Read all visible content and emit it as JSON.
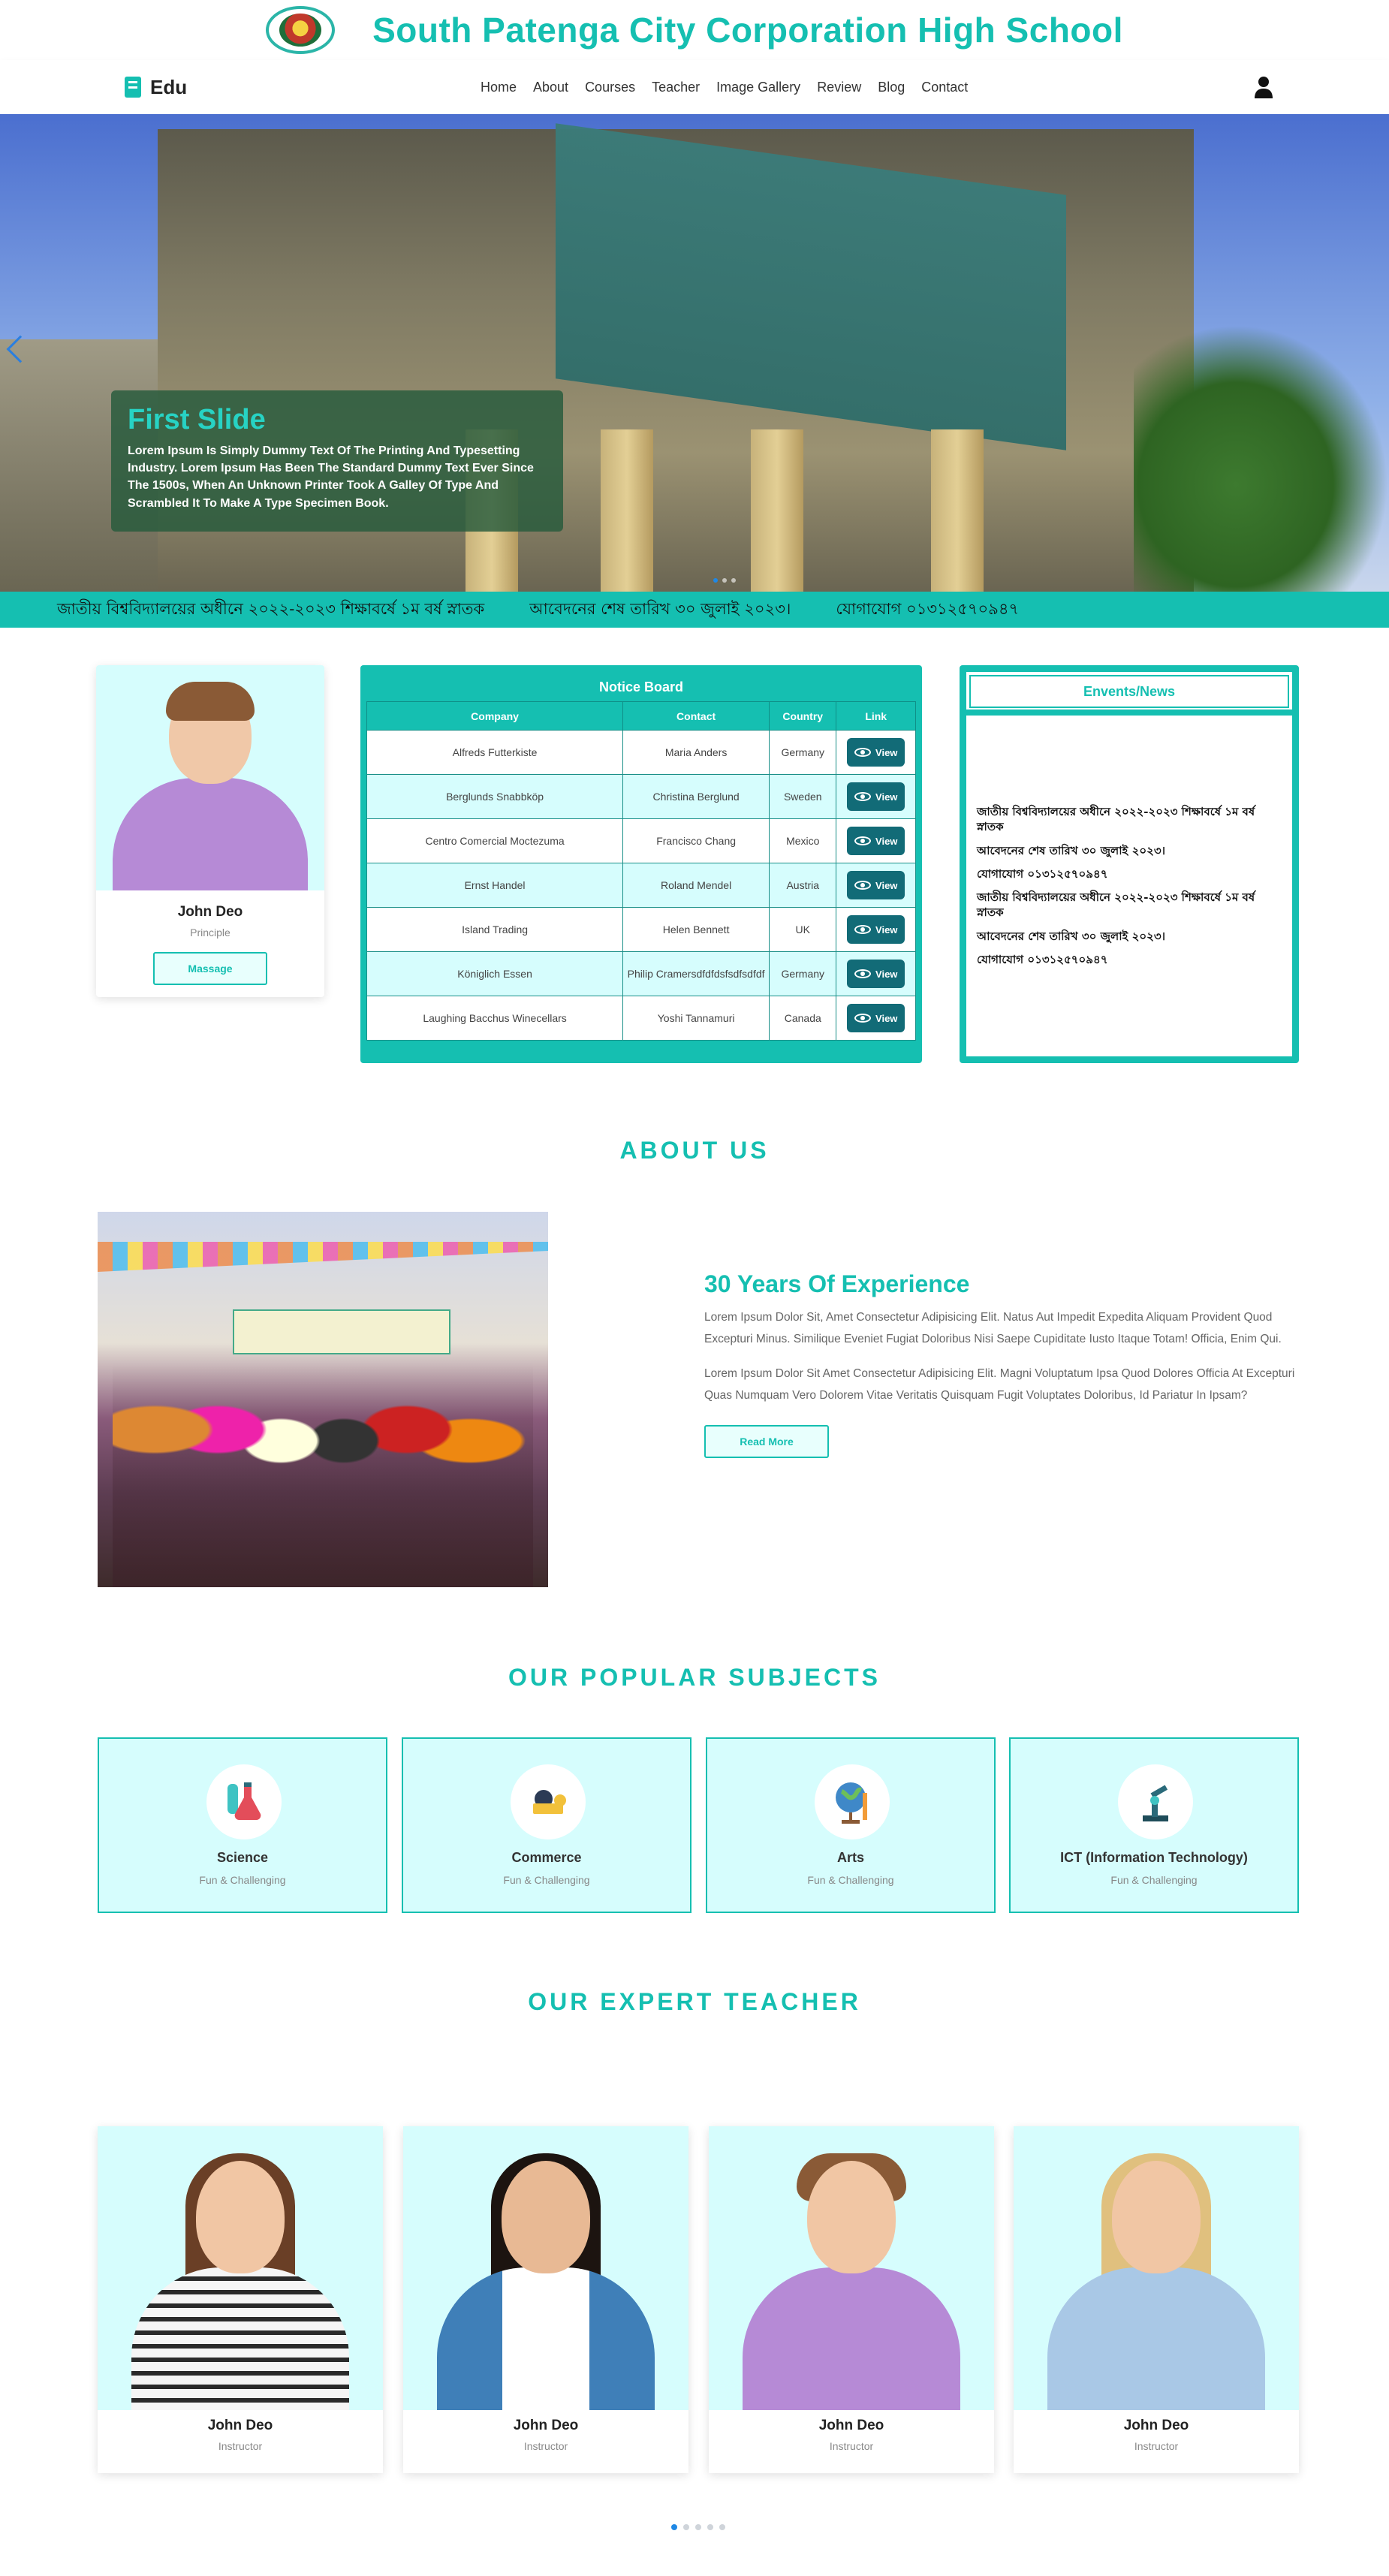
{
  "header": {
    "school_name": "South Patenga City Corporation High School"
  },
  "nav": {
    "brand": "Edu",
    "items": [
      "Home",
      "About",
      "Courses",
      "Teacher",
      "Image Gallery",
      "Review",
      "Blog",
      "Contact"
    ]
  },
  "hero": {
    "title": "First Slide",
    "text": "Lorem Ipsum Is Simply Dummy Text Of The Printing And Typesetting Industry. Lorem Ipsum Has Been The Standard Dummy Text Ever Since The 1500s, When An Unknown Printer Took A Galley Of Type And Scrambled It To Make A Type Specimen Book."
  },
  "marquee": {
    "items": [
      "জাতীয় বিশ্ববিদ্যালয়ের অধীনে ২০২২-২০২৩ শিক্ষাবর্ষে ১ম বর্ষ স্নাতক",
      "আবেদনের শেষ তারিখ ৩০ জুলাই ২০২৩।",
      "যোগাযোগ ০১৩১২৫৭০৯৪৭"
    ]
  },
  "principal": {
    "name": "John Deo",
    "role": "Principle",
    "button": "Massage"
  },
  "notice_board": {
    "title": "Notice Board",
    "columns": [
      "Company",
      "Contact",
      "Country",
      "Link"
    ],
    "view_label": "View",
    "rows": [
      [
        "Alfreds Futterkiste",
        "Maria Anders",
        "Germany"
      ],
      [
        "Berglunds Snabbköp",
        "Christina Berglund",
        "Sweden"
      ],
      [
        "Centro Comercial Moctezuma",
        "Francisco Chang",
        "Mexico"
      ],
      [
        "Ernst Handel",
        "Roland Mendel",
        "Austria"
      ],
      [
        "Island Trading",
        "Helen Bennett",
        "UK"
      ],
      [
        "Königlich Essen",
        "Philip Cramersdfdfdsfsdfsdfdf",
        "Germany"
      ],
      [
        "Laughing Bacchus Winecellars",
        "Yoshi Tannamuri",
        "Canada"
      ]
    ]
  },
  "events": {
    "title": "Envents/News",
    "items": [
      "জাতীয় বিশ্ববিদ্যালয়ের অধীনে ২০২২-২০২৩ শিক্ষাবর্ষে ১ম বর্ষ স্নাতক",
      "আবেদনের শেষ তারিখ ৩০ জুলাই ২০২৩।",
      "যোগাযোগ ০১৩১২৫৭০৯৪৭",
      "জাতীয় বিশ্ববিদ্যালয়ের অধীনে ২০২২-২০২৩ শিক্ষাবর্ষে ১ম বর্ষ স্নাতক",
      "আবেদনের শেষ তারিখ ৩০ জুলাই ২০২৩।",
      "যোগাযোগ ০১৩১২৫৭০৯৪৭"
    ]
  },
  "about": {
    "heading": "ABOUT US",
    "title": "30 Years Of Experience",
    "para1": "Lorem Ipsum Dolor Sit, Amet Consectetur Adipisicing Elit. Natus Aut Impedit Expedita Aliquam Provident Quod Excepturi Minus. Similique Eveniet Fugiat Doloribus Nisi Saepe Cupiditate Iusto Itaque Totam! Officia, Enim Qui.",
    "para2": "Lorem Ipsum Dolor Sit Amet Consectetur Adipisicing Elit. Magni Voluptatum Ipsa Quod Dolores Officia At Excepturi Quas Numquam Vero Dolorem Vitae Veritatis Quisquam Fugit Voluptates Doloribus, Id Pariatur In Ipsam?",
    "button": "Read More"
  },
  "subjects": {
    "heading": "OUR POPULAR SUBJECTS",
    "items": [
      {
        "name": "Science",
        "sub": "Fun & Challenging",
        "icon": "flask-icon"
      },
      {
        "name": "Commerce",
        "sub": "Fun & Challenging",
        "icon": "money-icon"
      },
      {
        "name": "Arts",
        "sub": "Fun & Challenging",
        "icon": "globe-icon"
      },
      {
        "name": "ICT (Information Technology)",
        "sub": "Fun & Challenging",
        "icon": "robot-arm-icon"
      }
    ]
  },
  "teachers": {
    "heading": "OUR EXPERT TEACHER",
    "items": [
      {
        "name": "John Deo",
        "role": "Instructor"
      },
      {
        "name": "John Deo",
        "role": "Instructor"
      },
      {
        "name": "John Deo",
        "role": "Instructor"
      },
      {
        "name": "John Deo",
        "role": "Instructor"
      }
    ],
    "active_page": 1,
    "page_count": 5
  },
  "colors": {
    "accent": "#15bfb1",
    "accent_dark": "#126b77",
    "accent_light": "#d6fdfd"
  }
}
